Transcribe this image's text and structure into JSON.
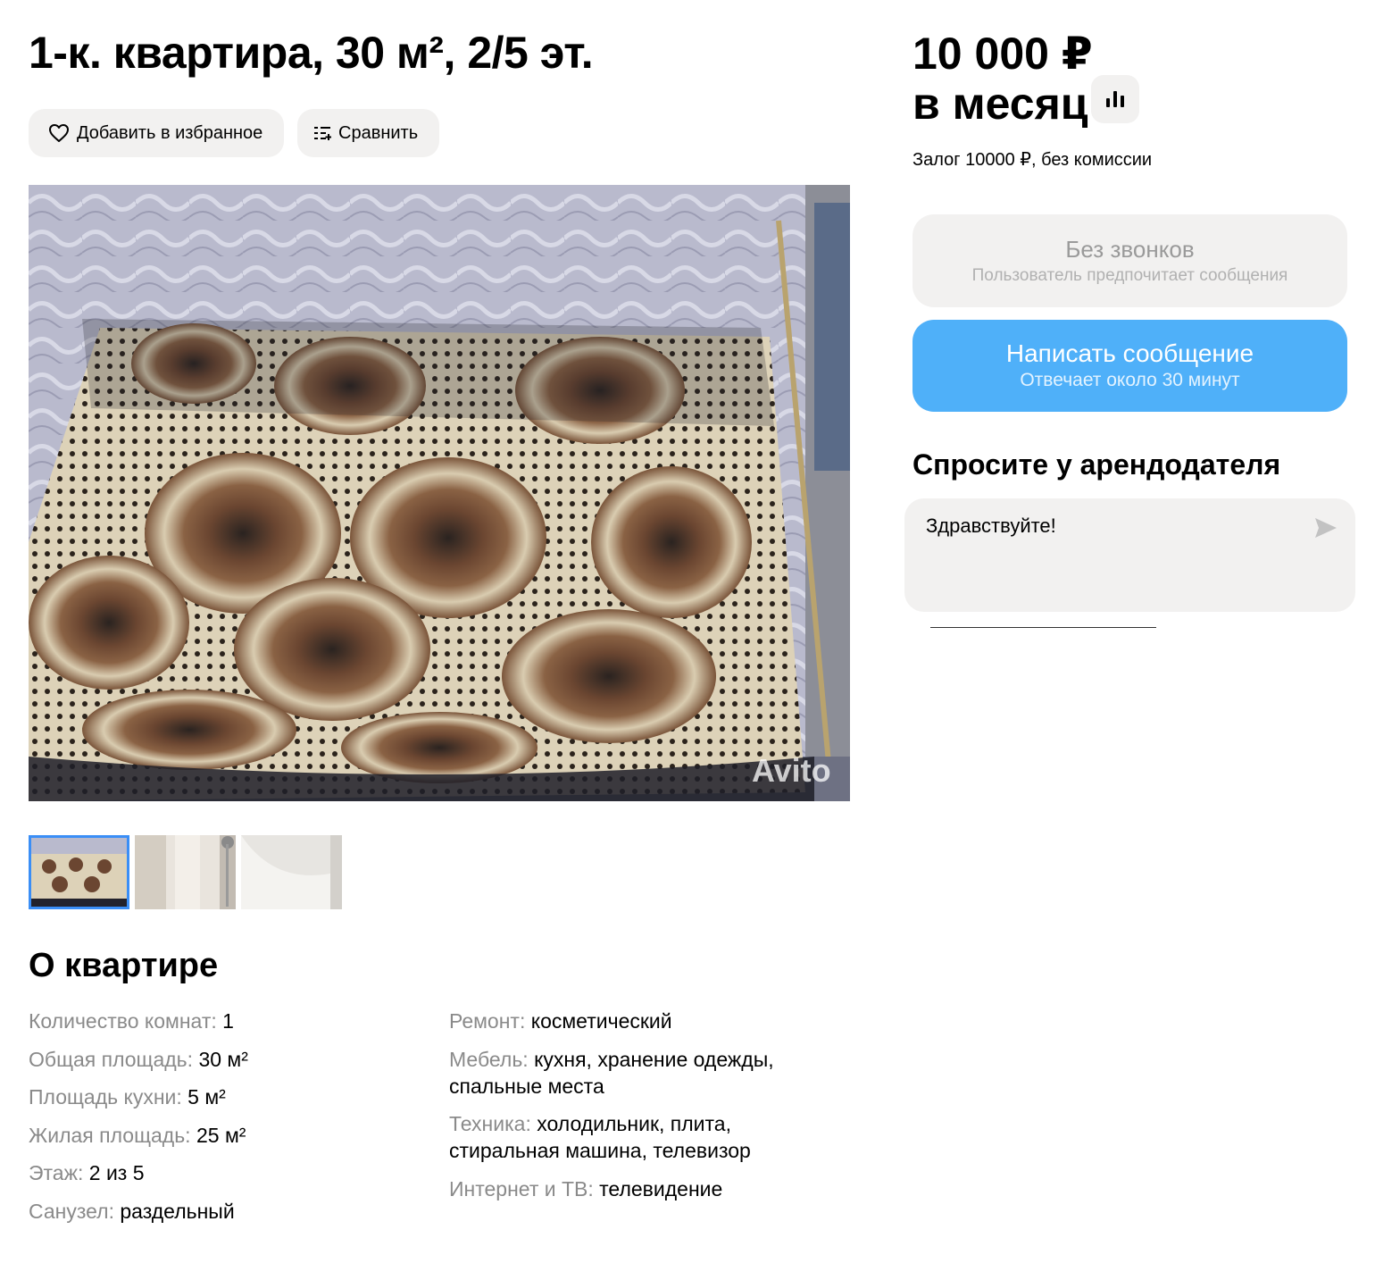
{
  "listing": {
    "title": "1-к. квартира, 30 м², 2/5 эт.",
    "favorite_label": "Добавить в избранное",
    "compare_label": "Сравнить"
  },
  "price": {
    "amount": "10 000 ₽",
    "period": "в месяц",
    "deposit": "Залог 10000 ₽, без комиссии"
  },
  "contact": {
    "no_calls_title": "Без звонков",
    "no_calls_subtitle": "Пользователь предпочитает сообщения",
    "message_button": "Написать сообщение",
    "message_subtitle": "Отвечает около 30 минут",
    "ask_title": "Спросите у арендодателя",
    "chat_value": "Здравствуйте!"
  },
  "gallery": {
    "watermark": "Avito",
    "thumbnail_count": 3,
    "active_index": 0
  },
  "about": {
    "title": "О квартире",
    "col1": [
      {
        "key": "Количество комнат:",
        "value": "1"
      },
      {
        "key": "Общая площадь:",
        "value": "30 м²"
      },
      {
        "key": "Площадь кухни:",
        "value": "5 м²"
      },
      {
        "key": "Жилая площадь:",
        "value": "25 м²"
      },
      {
        "key": "Этаж:",
        "value": "2 из 5"
      },
      {
        "key": "Санузел:",
        "value": "раздельный"
      }
    ],
    "col2": [
      {
        "key": "Ремонт:",
        "value": "косметический"
      },
      {
        "key": "Мебель:",
        "value": "кухня, хранение одежды, спальные места"
      },
      {
        "key": "Техника:",
        "value": "холодильник, плита, стиральная машина, телевизор"
      },
      {
        "key": "Интернет и ТВ:",
        "value": "телевидение"
      }
    ]
  },
  "colors": {
    "accent_blue": "#4fb0f9",
    "thumb_active_border": "#3a8ef6",
    "pill_bg": "#f2f1f0",
    "muted_text": "#8a8a8a"
  },
  "icons": [
    "heart-icon",
    "compare-icon",
    "bar-chart-icon",
    "send-icon"
  ]
}
